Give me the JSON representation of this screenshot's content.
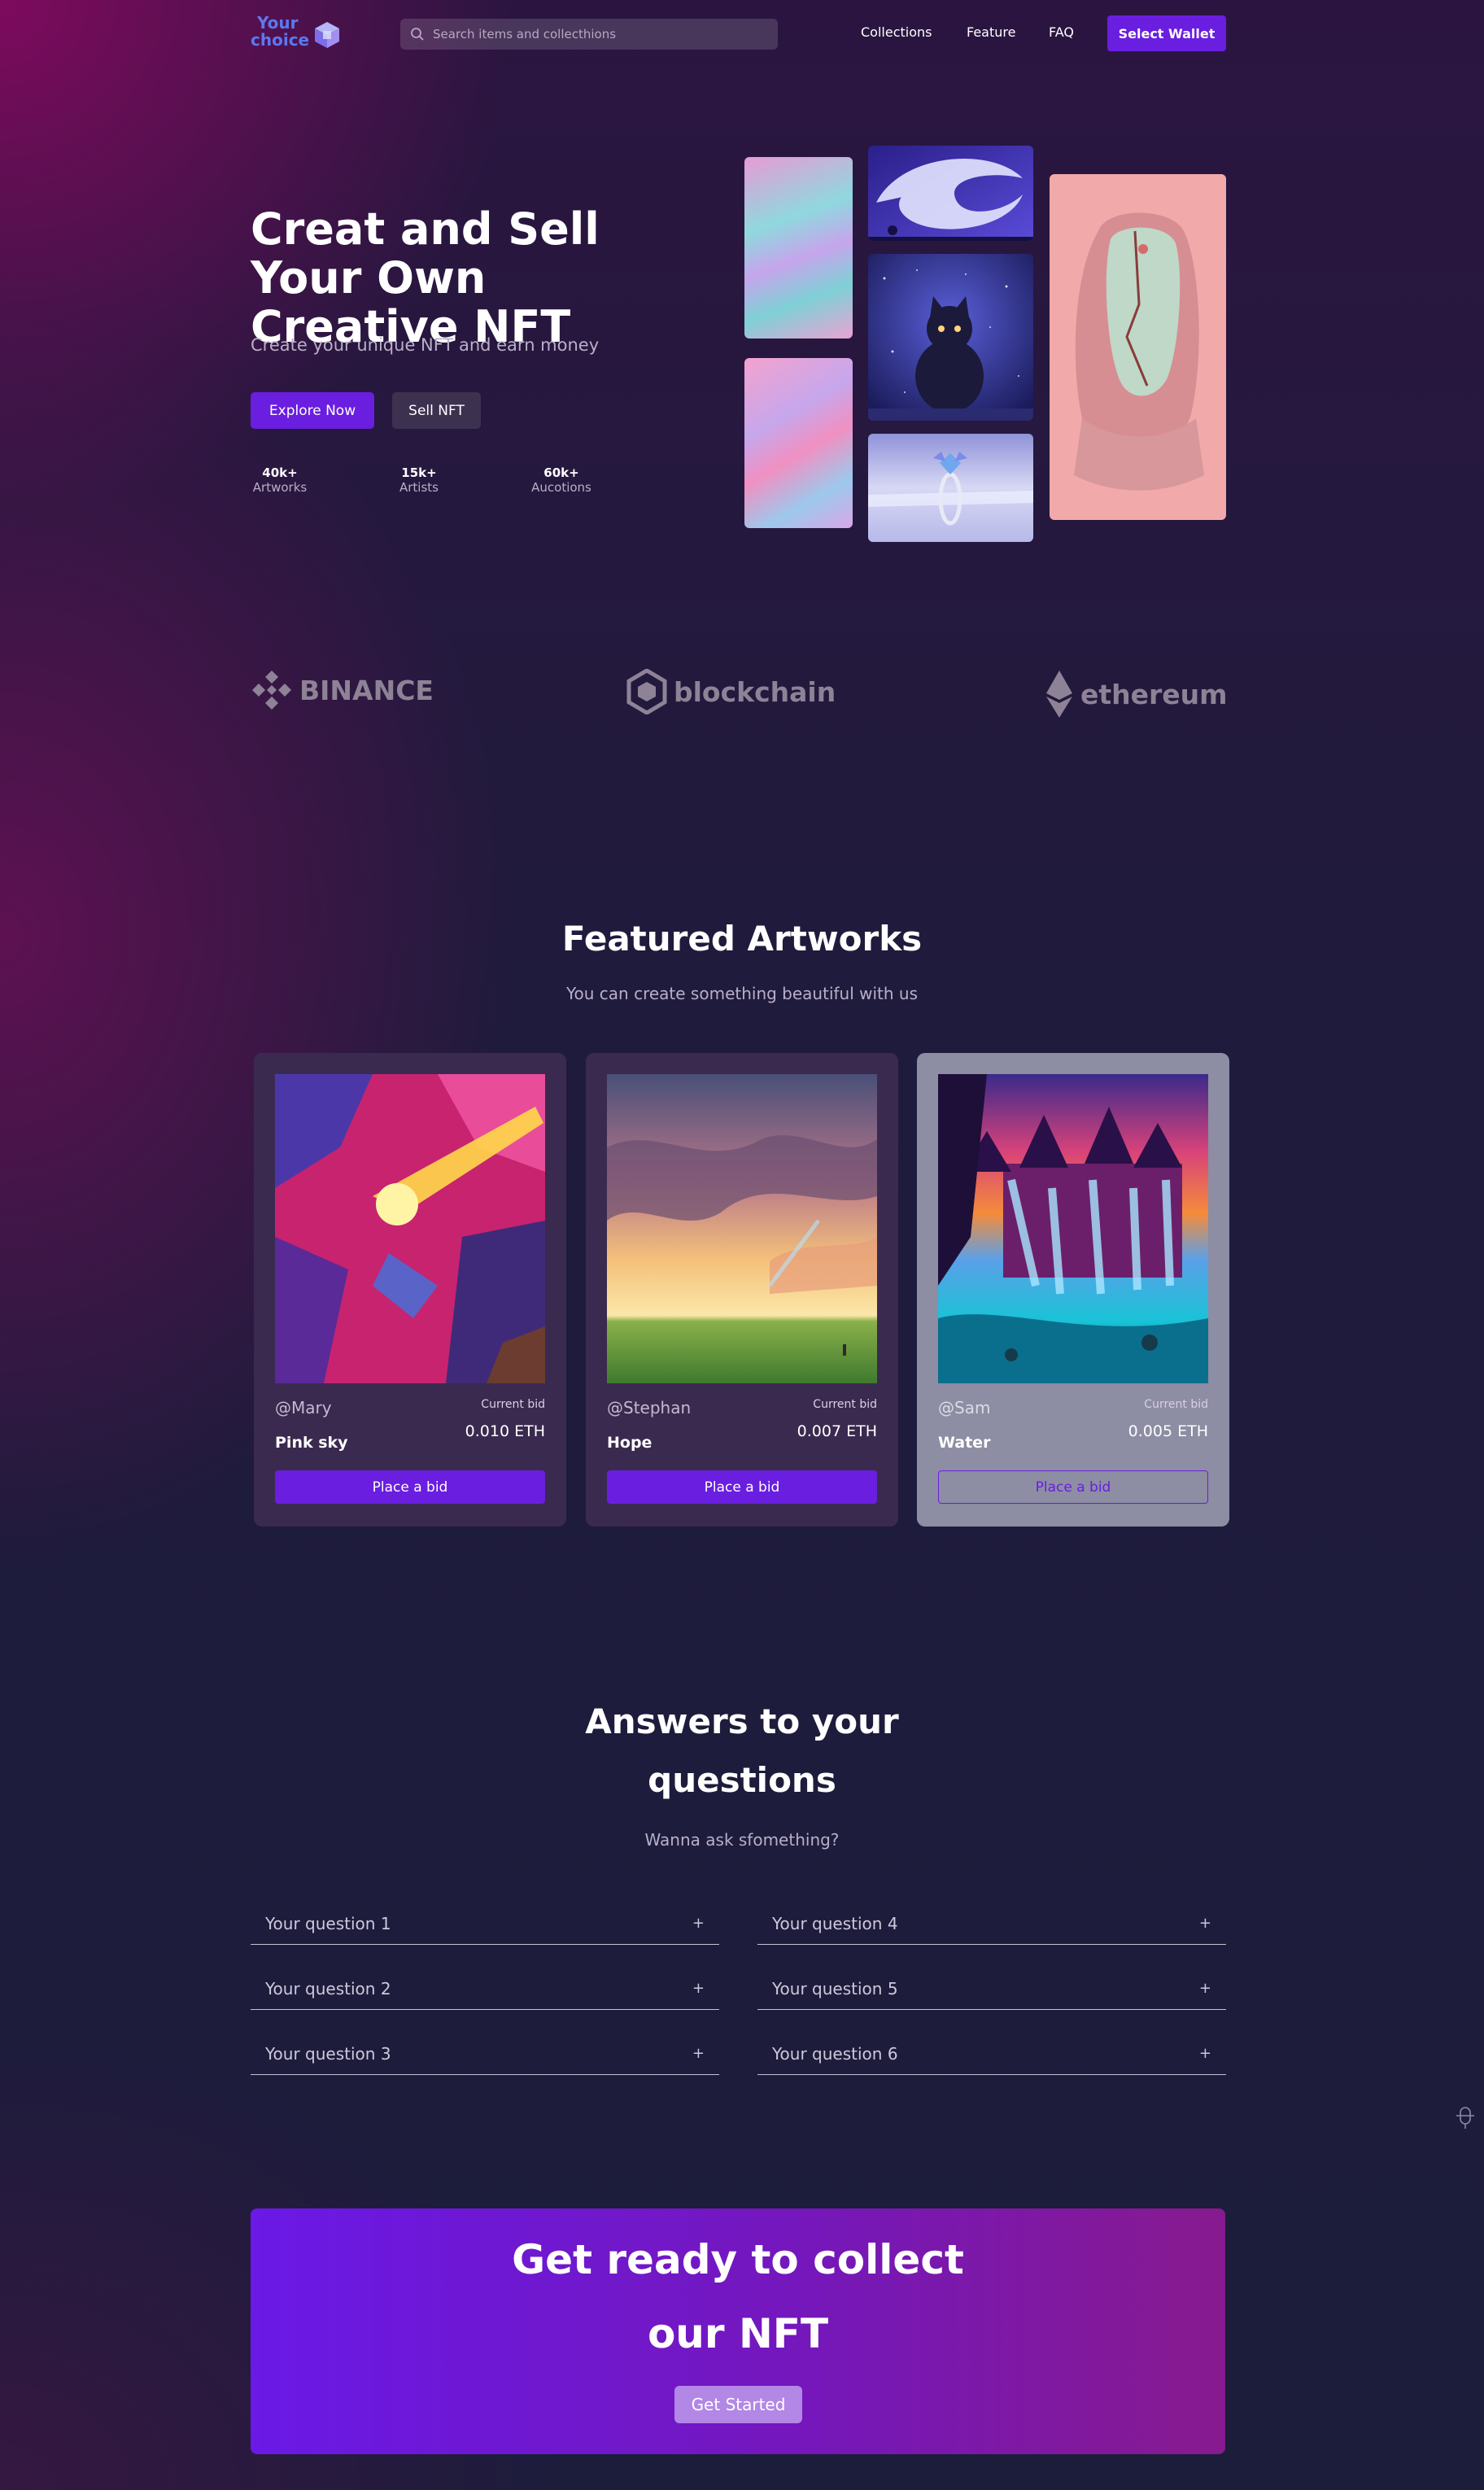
{
  "nav": {
    "logo_line1": "Your",
    "logo_line2": "choice",
    "search_placeholder": "Search items and collecthions",
    "links": [
      "Collections",
      "Feature",
      "FAQ"
    ],
    "wallet_button": "Select Wallet"
  },
  "hero": {
    "title": "Creat and Sell Your Own Creative NFT",
    "subtitle": "Create your unique NFT and earn money",
    "explore_button": "Explore Now",
    "sell_button": "Sell NFT",
    "stats": [
      {
        "value": "40k+",
        "label": "Artworks"
      },
      {
        "value": "15k+",
        "label": "Artists"
      },
      {
        "value": "60k+",
        "label": "Aucotions"
      }
    ]
  },
  "brands": [
    "BINANCE",
    "blockchain",
    "ethereum"
  ],
  "featured": {
    "title": "Featured Artworks",
    "subtitle": "You can create something beautiful with us",
    "cards": [
      {
        "user": "@Mary",
        "bid_label": "Current bid",
        "title": "Pink sky",
        "price": "0.010 ETH",
        "button": "Place a bid"
      },
      {
        "user": "@Stephan",
        "bid_label": "Current bid",
        "title": "Hope",
        "price": "0.007 ETH",
        "button": "Place a bid"
      },
      {
        "user": "@Sam",
        "bid_label": "Current bid",
        "title": "Water",
        "price": "0.005 ETH",
        "button": "Place a bid"
      }
    ]
  },
  "faq": {
    "title_line1": "Answers to your",
    "title_line2": "questions",
    "subtitle": "Wanna ask sfomething?",
    "questions": [
      "Your question 1",
      "Your question 2",
      "Your question 3",
      "Your question 4",
      "Your question 5",
      "Your question 6"
    ],
    "toggle": "+"
  },
  "cta": {
    "title_line1": "Get ready to collect",
    "title_line2": "our NFT",
    "button": "Get Started"
  },
  "colors": {
    "accent": "#6a1ee0",
    "logo": "#5b78f0",
    "muted_text": "#b9afc8"
  }
}
